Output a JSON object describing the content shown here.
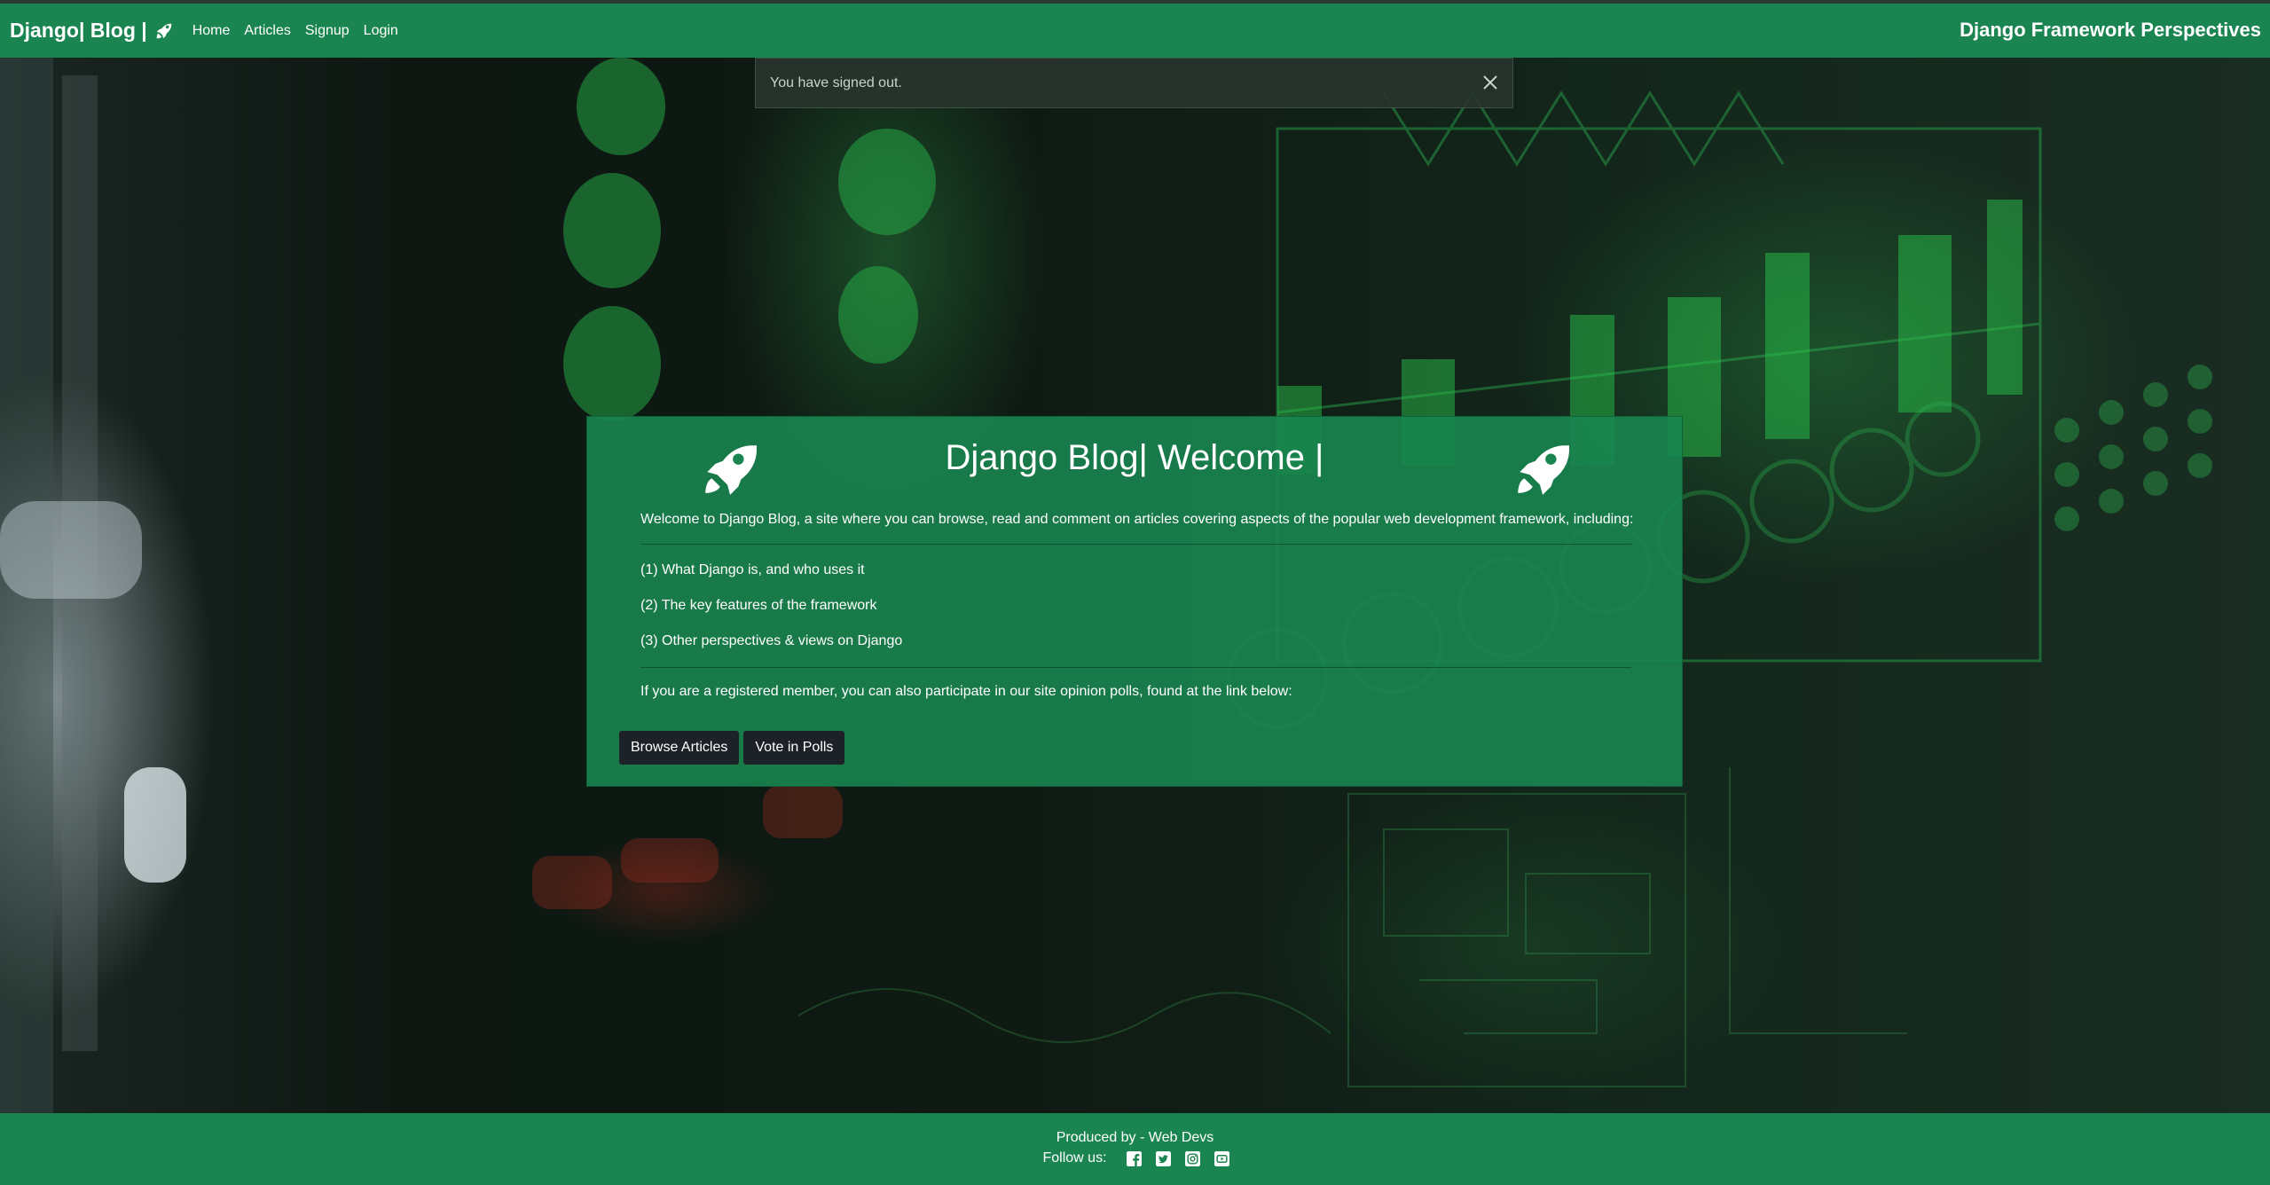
{
  "navbar": {
    "brand": "Django| Blog |",
    "brand_icon": "rocket-icon",
    "links": [
      "Home",
      "Articles",
      "Signup",
      "Login"
    ],
    "tagline": "Django Framework Perspectives",
    "background": "#1a8550"
  },
  "alert": {
    "message": "You have signed out.",
    "close_icon": "close-icon"
  },
  "welcome": {
    "title": "Django Blog| Welcome |",
    "intro": "Welcome to Django Blog, a site where you can browse, read and comment on articles covering aspects of the popular web development framework, including:",
    "features": [
      "(1) What Django is, and who uses it",
      "(2) The key features of the framework",
      "(3) Other perspectives & views on Django"
    ],
    "polls_text": "If you are a registered member, you can also participate in our site opinion polls, found at the link below:",
    "buttons": {
      "browse": "Browse Articles",
      "vote": "Vote in Polls"
    },
    "card_color": "#1a8550",
    "button_color": "#1d2228"
  },
  "footer": {
    "credit": "Produced by - Web Devs",
    "follow_label": "Follow us:",
    "social_icons": [
      "facebook-icon",
      "twitter-icon",
      "instagram-icon",
      "youtube-icon"
    ]
  }
}
